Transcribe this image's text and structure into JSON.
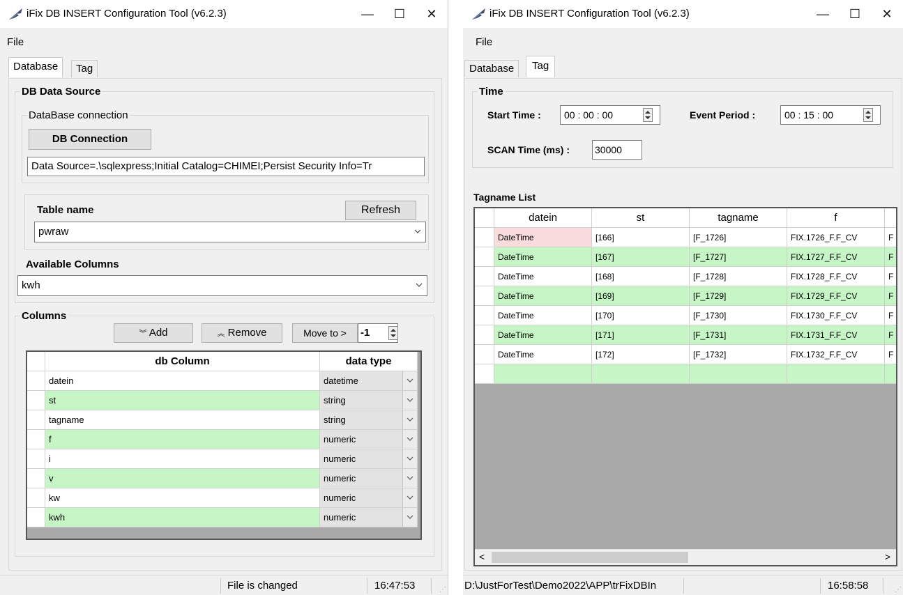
{
  "left_window": {
    "title": "iFix DB INSERT Configuration Tool (v6.2.3)",
    "controls": {
      "minimize": "—",
      "maximize": "☐",
      "close": "✕"
    },
    "menu": {
      "file": "File"
    },
    "tabs": [
      {
        "label": "Database",
        "active": true
      },
      {
        "label": "Tag",
        "active": false
      }
    ],
    "db_data_source": {
      "legend": "DB Data Source",
      "connection_group": "DataBase connection",
      "connect_button": "DB Connection",
      "connection_string": "Data Source=.\\sqlexpress;Initial Catalog=CHIMEI;Persist Security Info=Tr",
      "table_name_label": "Table name",
      "refresh_button": "Refresh",
      "table_name_value": "pwraw",
      "available_columns_label": "Available Columns",
      "available_columns_value": "kwh"
    },
    "columns": {
      "legend": "Columns",
      "add_button": "Add",
      "remove_button": "Remove",
      "move_to_button": "Move to >",
      "move_to_value": "-1",
      "headers": [
        "db Column",
        "data type"
      ],
      "rows": [
        {
          "column": "datein",
          "type": "datetime",
          "highlight": false
        },
        {
          "column": "st",
          "type": "string",
          "highlight": true
        },
        {
          "column": "tagname",
          "type": "string",
          "highlight": false
        },
        {
          "column": "f",
          "type": "numeric",
          "highlight": true
        },
        {
          "column": "i",
          "type": "numeric",
          "highlight": false
        },
        {
          "column": "v",
          "type": "numeric",
          "highlight": true
        },
        {
          "column": "kw",
          "type": "numeric",
          "highlight": false
        },
        {
          "column": "kwh",
          "type": "numeric",
          "highlight": true
        }
      ]
    },
    "status": {
      "message": "File is changed",
      "time": "16:47:53"
    }
  },
  "right_window": {
    "title": "iFix DB INSERT Configuration Tool (v6.2.3)",
    "controls": {
      "minimize": "—",
      "maximize": "☐",
      "close": "✕"
    },
    "menu": {
      "file": "File"
    },
    "tabs": [
      {
        "label": "Database",
        "active": false
      },
      {
        "label": "Tag",
        "active": true
      }
    ],
    "time": {
      "legend": "Time",
      "start_time_label": "Start Time :",
      "start_time_value": "00 : 00 : 00",
      "event_period_label": "Event Period :",
      "event_period_value": "00 : 15 : 00",
      "scan_time_label": "SCAN Time  (ms) :",
      "scan_time_value": "30000"
    },
    "tagname_list": {
      "label": "Tagname List",
      "headers": [
        "datein",
        "st",
        "tagname",
        "f"
      ],
      "rows": [
        {
          "datein": "DateTime",
          "st": "[166]",
          "tagname": "[F_1726]",
          "f": "FIX.1726_F.F_CV",
          "g": "F",
          "highlight": false,
          "selected": true
        },
        {
          "datein": "DateTime",
          "st": "[167]",
          "tagname": "[F_1727]",
          "f": "FIX.1727_F.F_CV",
          "g": "F",
          "highlight": true,
          "selected": false
        },
        {
          "datein": "DateTime",
          "st": "[168]",
          "tagname": "[F_1728]",
          "f": "FIX.1728_F.F_CV",
          "g": "F",
          "highlight": false,
          "selected": false
        },
        {
          "datein": "DateTime",
          "st": "[169]",
          "tagname": "[F_1729]",
          "f": "FIX.1729_F.F_CV",
          "g": "F",
          "highlight": true,
          "selected": false
        },
        {
          "datein": "DateTime",
          "st": "[170]",
          "tagname": "[F_1730]",
          "f": "FIX.1730_F.F_CV",
          "g": "F",
          "highlight": false,
          "selected": false
        },
        {
          "datein": "DateTime",
          "st": "[171]",
          "tagname": "[F_1731]",
          "f": "FIX.1731_F.F_CV",
          "g": "F",
          "highlight": true,
          "selected": false
        },
        {
          "datein": "DateTime",
          "st": "[172]",
          "tagname": "[F_1732]",
          "f": "FIX.1732_F.F_CV",
          "g": "F",
          "highlight": false,
          "selected": false
        }
      ],
      "scroll_left": "<",
      "scroll_right": ">"
    },
    "status": {
      "path": "D:\\JustForTest\\Demo2022\\APP\\trFixDBIn",
      "time": "16:58:58"
    }
  },
  "colors": {
    "row_green": "#c6f5c6",
    "row_selected": "#fbdcdc",
    "grid_empty": "#a9a9a9"
  }
}
